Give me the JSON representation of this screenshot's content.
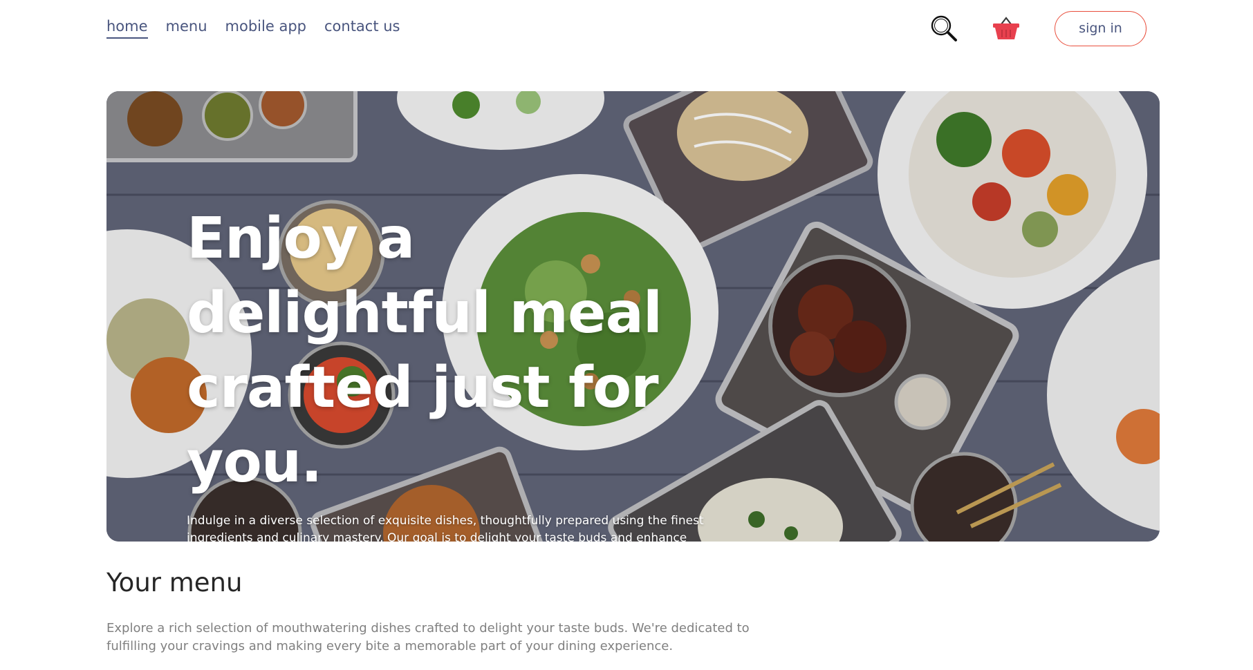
{
  "navbar": {
    "links": [
      "home",
      "menu",
      "mobile app",
      "contact us"
    ],
    "active_index": 0,
    "icons": [
      "search-icon",
      "basket-icon"
    ],
    "signin_label": "sign in"
  },
  "hero": {
    "title": "Enjoy a delightful meal crafted just for you.",
    "text": "Indulge in a diverse selection of exquisite dishes, thoughtfully prepared using the finest ingredients and culinary mastery. Our goal is to delight your taste buds and enhance your dining experience, one unforgettable meal at a time."
  },
  "menu": {
    "title": "Your menu",
    "description": "Explore a rich selection of mouthwatering dishes crafted to delight your taste buds. We're dedicated to fulfilling your cravings and making every bite a memorable part of your dining experience."
  },
  "colors": {
    "nav_text": "#49557e",
    "signin_border": "#e94e3c",
    "basket": "#e8404e",
    "heading": "#262626",
    "muted": "#808080"
  }
}
